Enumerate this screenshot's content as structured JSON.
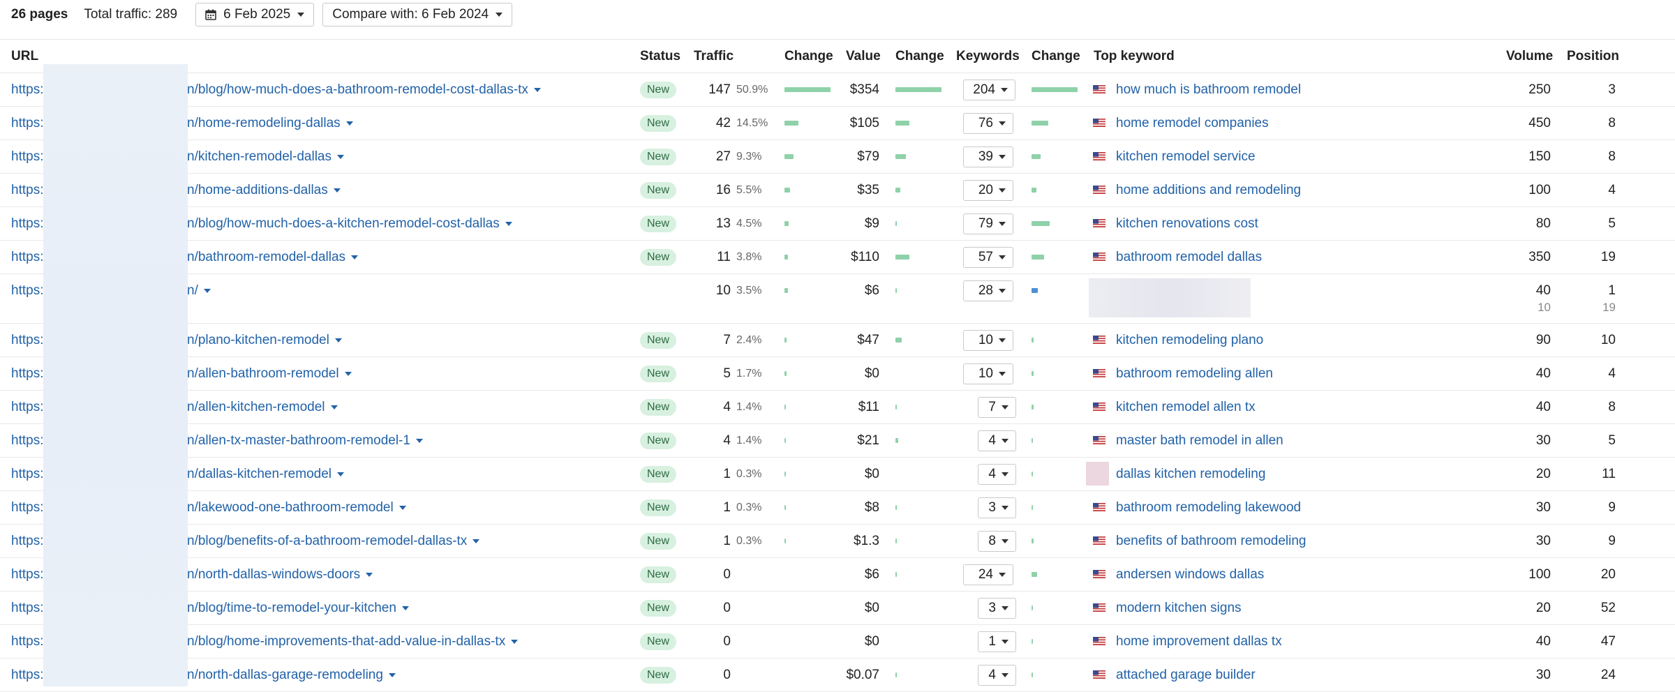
{
  "toolbar": {
    "pages_count": "26 pages",
    "total_traffic": "Total traffic: 289",
    "date_label": "6 Feb 2025",
    "compare_label": "Compare with: 6 Feb 2024"
  },
  "columns": {
    "url": "URL",
    "status": "Status",
    "traffic": "Traffic",
    "change": "Change",
    "value": "Value",
    "keywords": "Keywords",
    "top_keyword": "Top keyword",
    "volume": "Volume",
    "position": "Position"
  },
  "colors": {
    "link": "#2262a8",
    "bar": "#8fd1a9",
    "badge_bg": "#d7f0df"
  },
  "rows": [
    {
      "url_prefix": "https:",
      "url_path": "n/blog/how-much-does-a-bathroom-remodel-cost-dallas-tx",
      "status": "New",
      "traffic": "147",
      "share": "50.9%",
      "traffic_bar": 1.0,
      "value": "$354",
      "value_bar": 1.0,
      "keywords": "204",
      "kw_bar": 1.0,
      "top_keyword": "how much is bathroom remodel",
      "volume": "250",
      "position": "3"
    },
    {
      "url_prefix": "https:",
      "url_path": "n/home-remodeling-dallas",
      "status": "New",
      "traffic": "42",
      "share": "14.5%",
      "traffic_bar": 0.3,
      "value": "$105",
      "value_bar": 0.3,
      "keywords": "76",
      "kw_bar": 0.37,
      "top_keyword": "home remodel companies",
      "volume": "450",
      "position": "8"
    },
    {
      "url_prefix": "https:",
      "url_path": "n/kitchen-remodel-dallas",
      "status": "New",
      "traffic": "27",
      "share": "9.3%",
      "traffic_bar": 0.2,
      "value": "$79",
      "value_bar": 0.22,
      "keywords": "39",
      "kw_bar": 0.19,
      "top_keyword": "kitchen remodel service",
      "volume": "150",
      "position": "8"
    },
    {
      "url_prefix": "https:",
      "url_path": "n/home-additions-dallas",
      "status": "New",
      "traffic": "16",
      "share": "5.5%",
      "traffic_bar": 0.12,
      "value": "$35",
      "value_bar": 0.1,
      "keywords": "20",
      "kw_bar": 0.1,
      "top_keyword": "home additions and remodeling",
      "volume": "100",
      "position": "4"
    },
    {
      "url_prefix": "https:",
      "url_path": "n/blog/how-much-does-a-kitchen-remodel-cost-dallas",
      "status": "New",
      "traffic": "13",
      "share": "4.5%",
      "traffic_bar": 0.09,
      "value": "$9",
      "value_bar": 0.03,
      "keywords": "79",
      "kw_bar": 0.39,
      "top_keyword": "kitchen renovations cost",
      "volume": "80",
      "position": "5"
    },
    {
      "url_prefix": "https:",
      "url_path": "n/bathroom-remodel-dallas",
      "status": "New",
      "traffic": "11",
      "share": "3.8%",
      "traffic_bar": 0.08,
      "value": "$110",
      "value_bar": 0.31,
      "keywords": "57",
      "kw_bar": 0.28,
      "top_keyword": "bathroom remodel dallas",
      "volume": "350",
      "position": "19"
    },
    {
      "url_prefix": "https:",
      "url_path": "n/",
      "status": "",
      "traffic": "10",
      "share": "3.5%",
      "traffic_bar": 0.07,
      "value": "$6",
      "value_bar": 0.03,
      "keywords": "28",
      "kw_bar": 0.14,
      "top_keyword": "",
      "volume": "40",
      "volume_sub": "10",
      "position": "1",
      "position_sub": "19",
      "tall": true
    },
    {
      "url_prefix": "https:",
      "url_path": "n/plano-kitchen-remodel",
      "status": "New",
      "traffic": "7",
      "share": "2.4%",
      "traffic_bar": 0.05,
      "value": "$47",
      "value_bar": 0.14,
      "keywords": "10",
      "kw_bar": 0.05,
      "top_keyword": "kitchen remodeling plano",
      "volume": "90",
      "position": "10"
    },
    {
      "url_prefix": "https:",
      "url_path": "n/allen-bathroom-remodel",
      "status": "New",
      "traffic": "5",
      "share": "1.7%",
      "traffic_bar": 0.04,
      "value": "$0",
      "value_bar": 0,
      "keywords": "10",
      "kw_bar": 0.05,
      "top_keyword": "bathroom remodeling allen",
      "volume": "40",
      "position": "4"
    },
    {
      "url_prefix": "https:",
      "url_path": "n/allen-kitchen-remodel",
      "status": "New",
      "traffic": "4",
      "share": "1.4%",
      "traffic_bar": 0.03,
      "value": "$11",
      "value_bar": 0.03,
      "keywords": "7",
      "kw_bar": 0.04,
      "top_keyword": "kitchen remodel allen tx",
      "volume": "40",
      "position": "8"
    },
    {
      "url_prefix": "https:",
      "url_path": "n/allen-tx-master-bathroom-remodel-1",
      "status": "New",
      "traffic": "4",
      "share": "1.4%",
      "traffic_bar": 0.03,
      "value": "$21",
      "value_bar": 0.06,
      "keywords": "4",
      "kw_bar": 0.02,
      "top_keyword": "master bath remodel in allen",
      "volume": "30",
      "position": "5"
    },
    {
      "url_prefix": "https:",
      "url_path": "n/dallas-kitchen-remodel",
      "status": "New",
      "traffic": "1",
      "share": "0.3%",
      "traffic_bar": 0.01,
      "value": "$0",
      "value_bar": 0,
      "keywords": "4",
      "kw_bar": 0.02,
      "top_keyword": "dallas kitchen remodeling",
      "volume": "20",
      "position": "11"
    },
    {
      "url_prefix": "https:",
      "url_path": "n/lakewood-one-bathroom-remodel",
      "status": "New",
      "traffic": "1",
      "share": "0.3%",
      "traffic_bar": 0.01,
      "value": "$8",
      "value_bar": 0.02,
      "keywords": "3",
      "kw_bar": 0.015,
      "top_keyword": "bathroom remodeling lakewood",
      "volume": "30",
      "position": "9"
    },
    {
      "url_prefix": "https:",
      "url_path": "n/blog/benefits-of-a-bathroom-remodel-dallas-tx",
      "status": "New",
      "traffic": "1",
      "share": "0.3%",
      "traffic_bar": 0.01,
      "value": "$1.3",
      "value_bar": 0.01,
      "keywords": "8",
      "kw_bar": 0.04,
      "top_keyword": "benefits of bathroom remodeling",
      "volume": "30",
      "position": "9"
    },
    {
      "url_prefix": "https:",
      "url_path": "n/north-dallas-windows-doors",
      "status": "New",
      "traffic": "0",
      "share": "",
      "traffic_bar": 0,
      "value": "$6",
      "value_bar": 0.02,
      "keywords": "24",
      "kw_bar": 0.12,
      "top_keyword": "andersen windows dallas",
      "volume": "100",
      "position": "20"
    },
    {
      "url_prefix": "https:",
      "url_path": "n/blog/time-to-remodel-your-kitchen",
      "status": "New",
      "traffic": "0",
      "share": "",
      "traffic_bar": 0,
      "value": "$0",
      "value_bar": 0,
      "keywords": "3",
      "kw_bar": 0.015,
      "top_keyword": "modern kitchen signs",
      "volume": "20",
      "position": "52"
    },
    {
      "url_prefix": "https:",
      "url_path": "n/blog/home-improvements-that-add-value-in-dallas-tx",
      "status": "New",
      "traffic": "0",
      "share": "",
      "traffic_bar": 0,
      "value": "$0",
      "value_bar": 0,
      "keywords": "1",
      "kw_bar": 0.01,
      "top_keyword": "home improvement dallas tx",
      "volume": "40",
      "position": "47"
    },
    {
      "url_prefix": "https:",
      "url_path": "n/north-dallas-garage-remodeling",
      "status": "New",
      "traffic": "0",
      "share": "",
      "traffic_bar": 0,
      "value": "$0.07",
      "value_bar": 0.01,
      "keywords": "4",
      "kw_bar": 0.02,
      "top_keyword": "attached garage builder",
      "volume": "30",
      "position": "24"
    }
  ]
}
